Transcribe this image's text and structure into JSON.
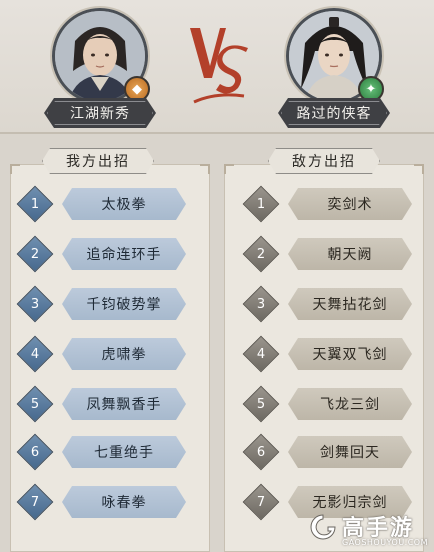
{
  "player": {
    "name": "江湖新秀",
    "badge_icon": "gold-coin-badge-icon"
  },
  "opponent": {
    "name": "路过的侠客",
    "badge_icon": "green-leaf-badge-icon"
  },
  "versus_label": "VS",
  "our_moves": {
    "header": "我方出招",
    "items": [
      {
        "num": "1",
        "label": "太极拳"
      },
      {
        "num": "2",
        "label": "追命连环手"
      },
      {
        "num": "3",
        "label": "千钧破势掌"
      },
      {
        "num": "4",
        "label": "虎啸拳"
      },
      {
        "num": "5",
        "label": "凤舞飘香手"
      },
      {
        "num": "6",
        "label": "七重绝手"
      },
      {
        "num": "7",
        "label": "咏春拳"
      }
    ]
  },
  "enemy_moves": {
    "header": "敌方出招",
    "items": [
      {
        "num": "1",
        "label": "奕剑术"
      },
      {
        "num": "2",
        "label": "朝天阙"
      },
      {
        "num": "3",
        "label": "天舞拈花剑"
      },
      {
        "num": "4",
        "label": "天翼双飞剑"
      },
      {
        "num": "5",
        "label": "飞龙三剑"
      },
      {
        "num": "6",
        "label": "剑舞回天"
      },
      {
        "num": "7",
        "label": "无影归宗剑"
      }
    ]
  },
  "watermark": {
    "title": "高手游",
    "url": "GAOSHOUYOU.COM"
  },
  "colors": {
    "accent_red": "#b3402a",
    "our_skill_blue": "#aebfd2",
    "enemy_skill_gray": "#c4bdb0",
    "nameplate_dark": "#3f4044"
  }
}
